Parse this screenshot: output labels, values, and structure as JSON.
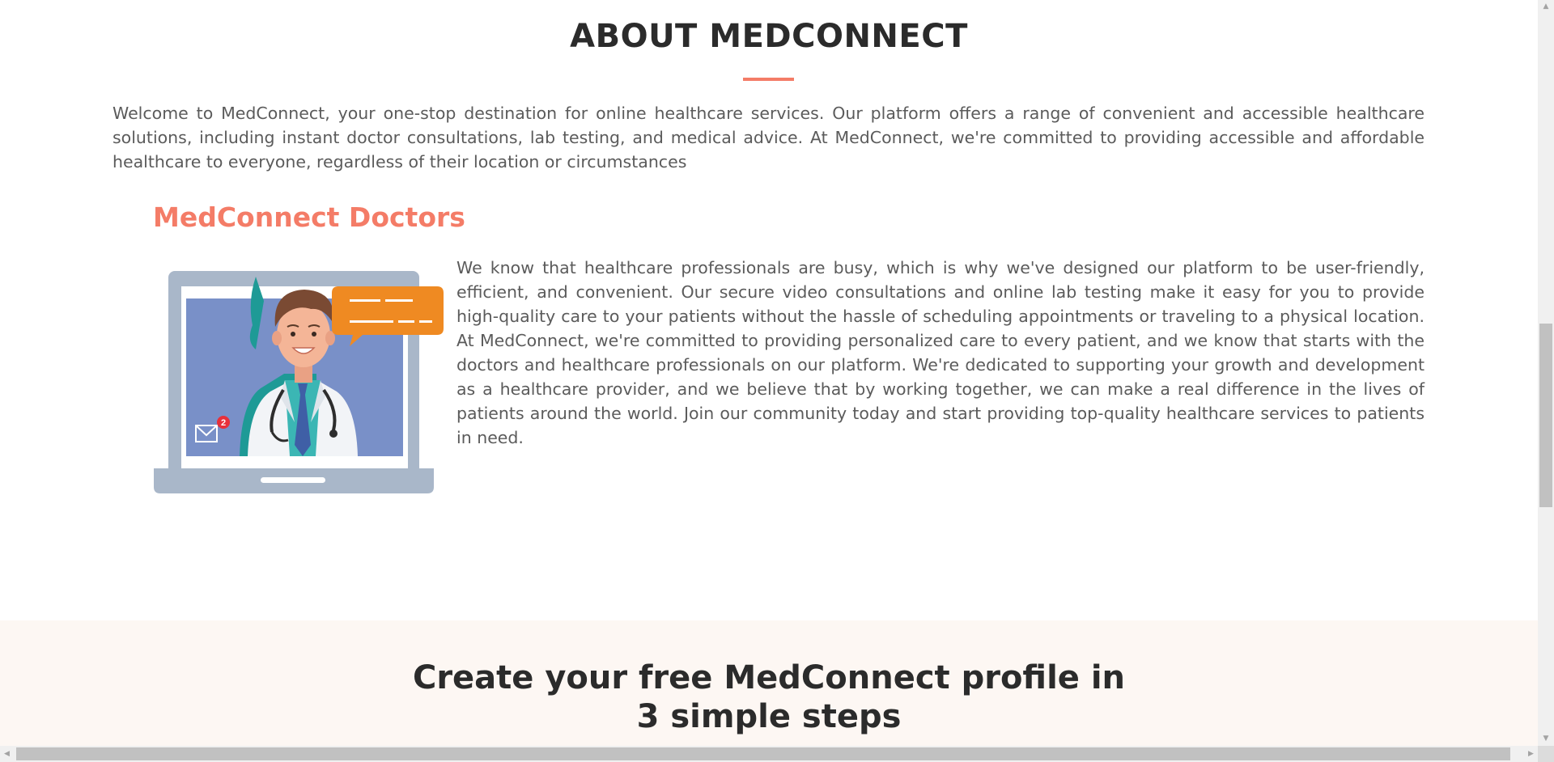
{
  "about": {
    "title": "ABOUT MEDCONNECT",
    "intro": "Welcome to MedConnect, your one-stop destination for online healthcare services. Our platform offers a range of convenient and accessible healthcare solutions, including instant doctor consultations, lab testing, and medical advice. At MedConnect, we're committed to providing accessible and affordable healthcare to everyone, regardless of their location or circumstances",
    "accent_color": "#f47c67"
  },
  "doctors": {
    "heading": "MedConnect Doctors",
    "body": "We know that healthcare professionals are busy, which is why we've designed our platform to be user-friendly, efficient, and convenient. Our secure video consultations and online lab testing make it easy for you to provide high-quality care to your patients without the hassle of scheduling appointments or traveling to a physical location. At MedConnect, we're committed to providing personalized care to every patient, and we know that starts with the doctors and healthcare professionals on our platform. We're dedicated to supporting your growth and development as a healthcare provider, and we believe that by working together, we can make a real difference in the lives of patients around the world. Join our community today and start providing top-quality healthcare services to patients in need.",
    "illustration": {
      "icon": "doctor-on-laptop-illustration",
      "notification_count": "2"
    }
  },
  "steps": {
    "title_line1": "Create your free MedConnect profile in",
    "title_line2": "3 simple steps",
    "background": "#fdf7f3"
  },
  "scrollbars": {
    "vertical": "vertical-scrollbar",
    "horizontal": "horizontal-scrollbar"
  }
}
